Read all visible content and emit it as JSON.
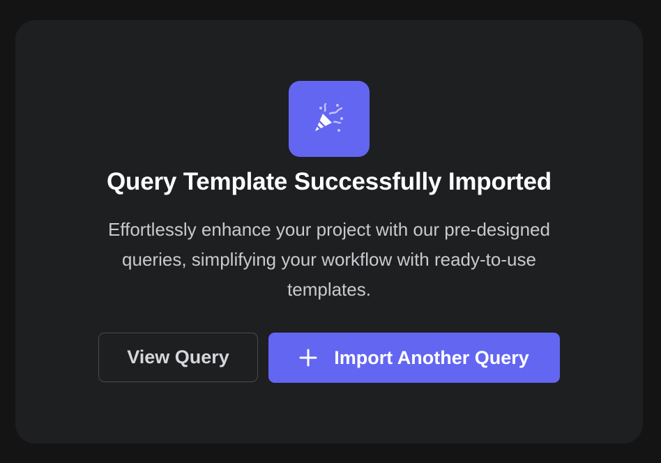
{
  "dialog": {
    "icon": "party-popper-icon",
    "title": "Query Template Successfully Imported",
    "description": "Effortlessly enhance your project with our pre-designed queries, simplifying your workflow with ready-to-use templates.",
    "view_button_label": "View Query",
    "import_button_label": "Import Another Query",
    "import_button_icon": "plus-icon"
  },
  "colors": {
    "background": "#141415",
    "card": "#1e1f21",
    "accent": "#6366f1",
    "title_text": "#ffffff",
    "body_text": "#c9cacd"
  }
}
